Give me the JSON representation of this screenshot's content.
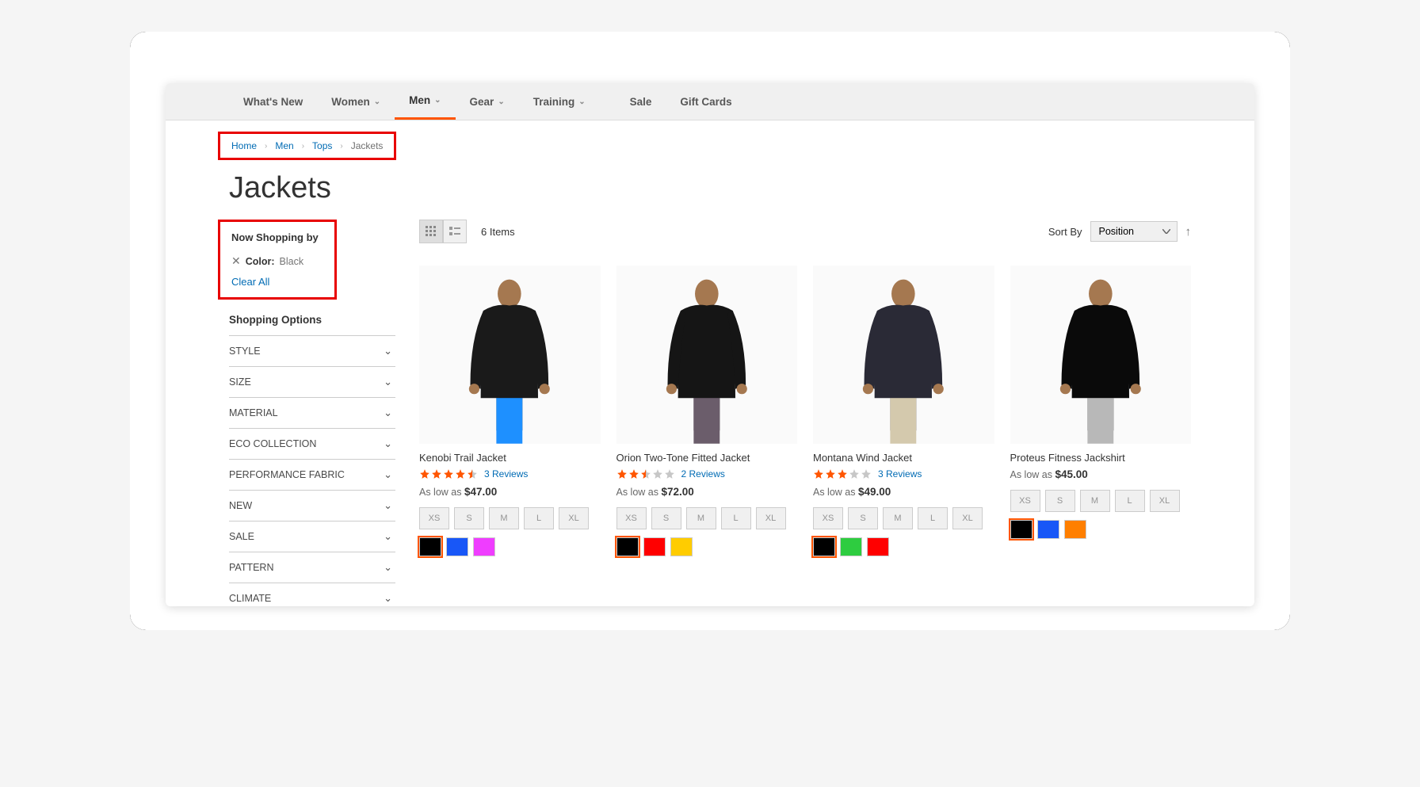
{
  "nav": {
    "items": [
      {
        "label": "What's New",
        "dropdown": false
      },
      {
        "label": "Women",
        "dropdown": true
      },
      {
        "label": "Men",
        "dropdown": true,
        "active": true
      },
      {
        "label": "Gear",
        "dropdown": true
      },
      {
        "label": "Training",
        "dropdown": true
      },
      {
        "label": "Sale",
        "dropdown": false
      },
      {
        "label": "Gift Cards",
        "dropdown": false
      }
    ]
  },
  "breadcrumbs": [
    "Home",
    "Men",
    "Tops",
    "Jackets"
  ],
  "page_title": "Jackets",
  "now_shopping": {
    "title": "Now Shopping by",
    "filter_label": "Color:",
    "filter_value": "Black",
    "clear_label": "Clear All"
  },
  "shopping_options": {
    "title": "Shopping Options",
    "filters": [
      "STYLE",
      "SIZE",
      "MATERIAL",
      "ECO COLLECTION",
      "PERFORMANCE FABRIC",
      "NEW",
      "SALE",
      "PATTERN",
      "CLIMATE"
    ]
  },
  "toolbar": {
    "item_count": "6 Items",
    "sort_label": "Sort By",
    "sort_value": "Position"
  },
  "products": [
    {
      "name": "Kenobi Trail Jacket",
      "rating": 4.5,
      "reviews": "3  Reviews",
      "price_prefix": "As low as ",
      "price": "$47.00",
      "sizes": [
        "XS",
        "S",
        "M",
        "L",
        "XL"
      ],
      "colors": [
        {
          "hex": "#000000",
          "selected": true
        },
        {
          "hex": "#1857f7"
        },
        {
          "hex": "#ef3dff"
        }
      ],
      "shirt_fill": "#1a1a1a",
      "pants_fill": "#1e90ff"
    },
    {
      "name": "Orion Two-Tone Fitted Jacket",
      "rating": 2.5,
      "reviews": "2  Reviews",
      "price_prefix": "As low as ",
      "price": "$72.00",
      "sizes": [
        "XS",
        "S",
        "M",
        "L",
        "XL"
      ],
      "colors": [
        {
          "hex": "#000000",
          "selected": true
        },
        {
          "hex": "#ff0000"
        },
        {
          "hex": "#ffcc00"
        }
      ],
      "shirt_fill": "#151515",
      "pants_fill": "#6b5d6b"
    },
    {
      "name": "Montana Wind Jacket",
      "rating": 3.0,
      "reviews": "3  Reviews",
      "price_prefix": "As low as ",
      "price": "$49.00",
      "sizes": [
        "XS",
        "S",
        "M",
        "L",
        "XL"
      ],
      "colors": [
        {
          "hex": "#000000",
          "selected": true
        },
        {
          "hex": "#2ecc40"
        },
        {
          "hex": "#ff0000"
        }
      ],
      "shirt_fill": "#2a2a36",
      "pants_fill": "#d4c9ad"
    },
    {
      "name": "Proteus Fitness Jackshirt",
      "rating": 0,
      "reviews": "",
      "price_prefix": "As low as ",
      "price": "$45.00",
      "sizes": [
        "XS",
        "S",
        "M",
        "L",
        "XL"
      ],
      "colors": [
        {
          "hex": "#000000",
          "selected": true
        },
        {
          "hex": "#1857f7"
        },
        {
          "hex": "#ff7f00"
        }
      ],
      "shirt_fill": "#0a0a0a",
      "pants_fill": "#b8b8b8"
    }
  ]
}
